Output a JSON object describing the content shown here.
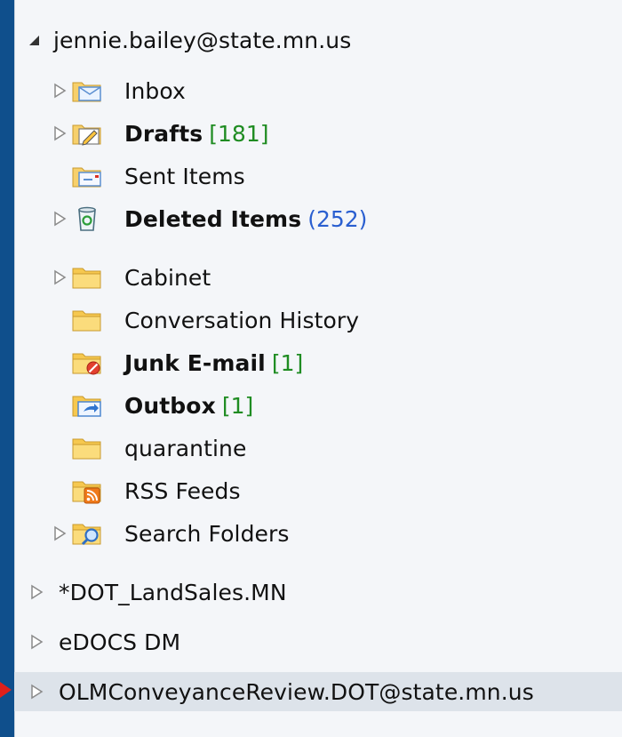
{
  "account": {
    "email": "jennie.bailey@state.mn.us",
    "folders": [
      {
        "label": "Inbox",
        "count": "",
        "bold": false,
        "icon": "inbox-icon"
      },
      {
        "label": "Drafts",
        "count": "[181]",
        "bold": true,
        "icon": "drafts-icon"
      },
      {
        "label": "Sent Items",
        "count": "",
        "bold": false,
        "icon": "sent-items-icon"
      },
      {
        "label": "Deleted Items",
        "count": "(252)",
        "bold": true,
        "icon": "deleted-items-icon"
      },
      {
        "label": "Cabinet",
        "count": "",
        "bold": false,
        "icon": "folder-icon"
      },
      {
        "label": "Conversation History",
        "count": "",
        "bold": false,
        "icon": "folder-icon"
      },
      {
        "label": "Junk E-mail",
        "count": "[1]",
        "bold": true,
        "icon": "junk-email-icon"
      },
      {
        "label": "Outbox",
        "count": "[1]",
        "bold": true,
        "icon": "outbox-icon"
      },
      {
        "label": "quarantine",
        "count": "",
        "bold": false,
        "icon": "folder-icon"
      },
      {
        "label": "RSS Feeds",
        "count": "",
        "bold": false,
        "icon": "rss-feeds-icon"
      },
      {
        "label": "Search Folders",
        "count": "",
        "bold": false,
        "icon": "search-folders-icon"
      }
    ]
  },
  "mailboxes": [
    {
      "label": "*DOT_LandSales.MN"
    },
    {
      "label": "eDOCS DM"
    },
    {
      "label": "OLMConveyanceReview.DOT@state.mn.us"
    }
  ],
  "colors": {
    "frame": "#0f4f8c",
    "pane": "#f4f6f9",
    "highlight": "#dde3ea",
    "unread_green": "#1f8c22",
    "unread_blue": "#2a5fd0",
    "marker": "#e0201b"
  }
}
